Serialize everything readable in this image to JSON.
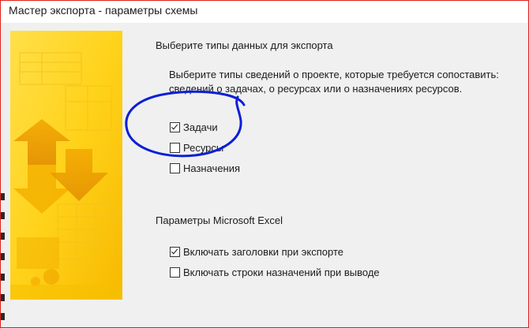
{
  "window": {
    "title": "Мастер экспорта - параметры схемы"
  },
  "data_types": {
    "heading": "Выберите типы данных для экспорта",
    "description": "Выберите типы сведений о проекте, которые требуется сопоставить: сведений о задачах, о ресурсах или о назначениях ресурсов.",
    "options": [
      {
        "label": "Задачи",
        "checked": true
      },
      {
        "label": "Ресурсы",
        "checked": false
      },
      {
        "label": "Назначения",
        "checked": false
      }
    ]
  },
  "excel": {
    "heading": "Параметры Microsoft Excel",
    "options": [
      {
        "label": "Включать заголовки при экспорте",
        "checked": true
      },
      {
        "label": "Включать строки назначений при выводе",
        "checked": false
      }
    ]
  },
  "colors": {
    "window_border": "#e0201c",
    "banner_yellow": "#ffd21a",
    "annotation_ink": "#0a1fd8"
  },
  "icons": {
    "banner": "wizard-banner-arrows-icon",
    "checkbox": "checkbox-icon"
  }
}
